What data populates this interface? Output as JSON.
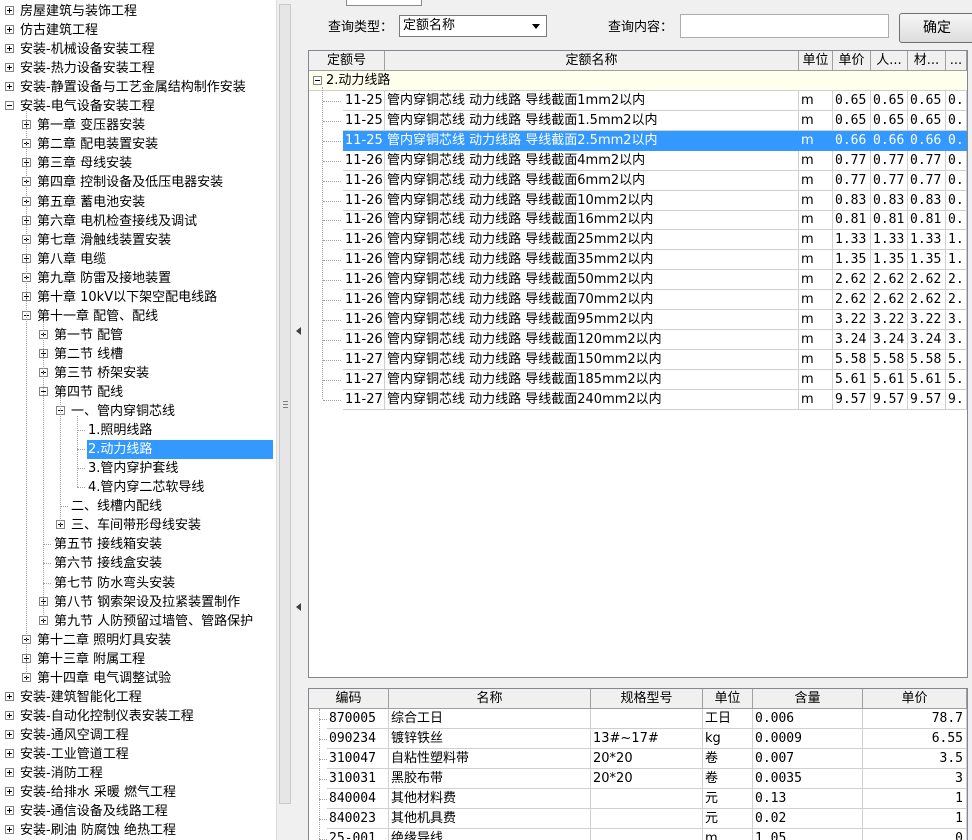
{
  "tree": {
    "nodes": [
      {
        "label": "房屋建筑与装饰工程",
        "level": 0,
        "exp": "plus"
      },
      {
        "label": "仿古建筑工程",
        "level": 0,
        "exp": "plus"
      },
      {
        "label": "安装-机械设备安装工程",
        "level": 0,
        "exp": "plus"
      },
      {
        "label": "安装-热力设备安装工程",
        "level": 0,
        "exp": "plus"
      },
      {
        "label": "安装-静置设备与工艺金属结构制作安装",
        "level": 0,
        "exp": "plus"
      },
      {
        "label": "安装-电气设备安装工程",
        "level": 0,
        "exp": "minus"
      },
      {
        "label": "第一章  变压器安装",
        "level": 1,
        "exp": "plus"
      },
      {
        "label": "第二章  配电装置安装",
        "level": 1,
        "exp": "plus"
      },
      {
        "label": "第三章  母线安装",
        "level": 1,
        "exp": "plus"
      },
      {
        "label": "第四章  控制设备及低压电器安装",
        "level": 1,
        "exp": "plus"
      },
      {
        "label": "第五章  蓄电池安装",
        "level": 1,
        "exp": "plus"
      },
      {
        "label": "第六章  电机检查接线及调试",
        "level": 1,
        "exp": "plus"
      },
      {
        "label": "第七章  滑触线装置安装",
        "level": 1,
        "exp": "plus"
      },
      {
        "label": "第八章  电缆",
        "level": 1,
        "exp": "plus"
      },
      {
        "label": "第九章  防雷及接地装置",
        "level": 1,
        "exp": "plus"
      },
      {
        "label": "第十章  10kV以下架空配电线路",
        "level": 1,
        "exp": "plus"
      },
      {
        "label": "第十一章  配管、配线",
        "level": 1,
        "exp": "minus"
      },
      {
        "label": "第一节  配管",
        "level": 2,
        "exp": "plus"
      },
      {
        "label": "第二节  线槽",
        "level": 2,
        "exp": "plus"
      },
      {
        "label": "第三节  桥架安装",
        "level": 2,
        "exp": "plus"
      },
      {
        "label": "第四节  配线",
        "level": 2,
        "exp": "minus"
      },
      {
        "label": "一、管内穿铜芯线",
        "level": 3,
        "exp": "minus"
      },
      {
        "label": "1.照明线路",
        "level": 4,
        "exp": "none"
      },
      {
        "label": "2.动力线路",
        "level": 4,
        "exp": "none",
        "selected": true
      },
      {
        "label": "3.管内穿护套线",
        "level": 4,
        "exp": "none"
      },
      {
        "label": "4.管内穿二芯软导线",
        "level": 4,
        "exp": "none"
      },
      {
        "label": "二、线槽内配线",
        "level": 3,
        "exp": "none"
      },
      {
        "label": "三、车间带形母线安装",
        "level": 3,
        "exp": "plus"
      },
      {
        "label": "第五节  接线箱安装",
        "level": 2,
        "exp": "none"
      },
      {
        "label": "第六节  接线盒安装",
        "level": 2,
        "exp": "none"
      },
      {
        "label": "第七节  防水弯头安装",
        "level": 2,
        "exp": "none"
      },
      {
        "label": "第八节  钢索架设及拉紧装置制作",
        "level": 2,
        "exp": "plus"
      },
      {
        "label": "第九节  人防预留过墙管、管路保护",
        "level": 2,
        "exp": "plus"
      },
      {
        "label": "第十二章  照明灯具安装",
        "level": 1,
        "exp": "plus"
      },
      {
        "label": "第十三章  附属工程",
        "level": 1,
        "exp": "plus"
      },
      {
        "label": "第十四章  电气调整试验",
        "level": 1,
        "exp": "plus"
      },
      {
        "label": "安装-建筑智能化工程",
        "level": 0,
        "exp": "plus"
      },
      {
        "label": "安装-自动化控制仪表安装工程",
        "level": 0,
        "exp": "plus"
      },
      {
        "label": "安装-通风空调工程",
        "level": 0,
        "exp": "plus"
      },
      {
        "label": "安装-工业管道工程",
        "level": 0,
        "exp": "plus"
      },
      {
        "label": "安装-消防工程",
        "level": 0,
        "exp": "plus"
      },
      {
        "label": "安装-给排水  采暖  燃气工程",
        "level": 0,
        "exp": "plus"
      },
      {
        "label": "安装-通信设备及线路工程",
        "level": 0,
        "exp": "plus"
      },
      {
        "label": "安装-刷油  防腐蚀  绝热工程",
        "level": 0,
        "exp": "plus"
      }
    ]
  },
  "query": {
    "type_label": "查询类型：",
    "type_value": "定额名称",
    "content_label": "查询内容：",
    "content_value": "",
    "confirm": "确定"
  },
  "grid1": {
    "headers": [
      "定额号",
      "定额名称",
      "单位",
      "单价",
      "人...",
      "材...",
      "..."
    ],
    "group": "2.动力线路",
    "rows": [
      [
        "11-25",
        "管内穿铜芯线  动力线路  导线截面1mm2以内",
        "m",
        "0.65",
        "0.65",
        "0.65",
        "0."
      ],
      [
        "11-25",
        "管内穿铜芯线  动力线路  导线截面1.5mm2以内",
        "m",
        "0.65",
        "0.65",
        "0.65",
        "0."
      ],
      [
        "11-25",
        "管内穿铜芯线  动力线路  导线截面2.5mm2以内",
        "m",
        "0.66",
        "0.66",
        "0.66",
        "0."
      ],
      [
        "11-26",
        "管内穿铜芯线  动力线路  导线截面4mm2以内",
        "m",
        "0.77",
        "0.77",
        "0.77",
        "0."
      ],
      [
        "11-26",
        "管内穿铜芯线  动力线路  导线截面6mm2以内",
        "m",
        "0.77",
        "0.77",
        "0.77",
        "0."
      ],
      [
        "11-26",
        "管内穿铜芯线  动力线路  导线截面10mm2以内",
        "m",
        "0.83",
        "0.83",
        "0.83",
        "0."
      ],
      [
        "11-26",
        "管内穿铜芯线  动力线路  导线截面16mm2以内",
        "m",
        "0.81",
        "0.81",
        "0.81",
        "0."
      ],
      [
        "11-26",
        "管内穿铜芯线  动力线路  导线截面25mm2以内",
        "m",
        "1.33",
        "1.33",
        "1.33",
        "1."
      ],
      [
        "11-26",
        "管内穿铜芯线  动力线路  导线截面35mm2以内",
        "m",
        "1.35",
        "1.35",
        "1.35",
        "1."
      ],
      [
        "11-26",
        "管内穿铜芯线  动力线路  导线截面50mm2以内",
        "m",
        "2.62",
        "2.62",
        "2.62",
        "2."
      ],
      [
        "11-26",
        "管内穿铜芯线  动力线路  导线截面70mm2以内",
        "m",
        "2.62",
        "2.62",
        "2.62",
        "2."
      ],
      [
        "11-26",
        "管内穿铜芯线  动力线路  导线截面95mm2以内",
        "m",
        "3.22",
        "3.22",
        "3.22",
        "3."
      ],
      [
        "11-26",
        "管内穿铜芯线  动力线路  导线截面120mm2以内",
        "m",
        "3.24",
        "3.24",
        "3.24",
        "3."
      ],
      [
        "11-27",
        "管内穿铜芯线  动力线路  导线截面150mm2以内",
        "m",
        "5.58",
        "5.58",
        "5.58",
        "5."
      ],
      [
        "11-27",
        "管内穿铜芯线  动力线路  导线截面185mm2以内",
        "m",
        "5.61",
        "5.61",
        "5.61",
        "5."
      ],
      [
        "11-27",
        "管内穿铜芯线  动力线路  导线截面240mm2以内",
        "m",
        "9.57",
        "9.57",
        "9.57",
        "9."
      ]
    ],
    "selected_row": 2
  },
  "grid2": {
    "headers": [
      "编码",
      "名称",
      "规格型号",
      "单位",
      "含量",
      "单价"
    ],
    "rows": [
      [
        "870005",
        "综合工日",
        "",
        "工日",
        "0.006",
        "78.7"
      ],
      [
        "090234",
        "镀锌铁丝",
        "13#~17#",
        "kg",
        "0.0009",
        "6.55"
      ],
      [
        "310047",
        "自粘性塑料带",
        "20*20",
        "卷",
        "0.007",
        "3.5"
      ],
      [
        "310031",
        "黑胶布带",
        "20*20",
        "卷",
        "0.0035",
        "3"
      ],
      [
        "840004",
        "其他材料费",
        "",
        "元",
        "0.13",
        "1"
      ],
      [
        "840023",
        "其他机具费",
        "",
        "元",
        "0.02",
        "1"
      ],
      [
        "25-001",
        "绝缘导线",
        "",
        "m",
        "1.05",
        "0"
      ]
    ]
  }
}
